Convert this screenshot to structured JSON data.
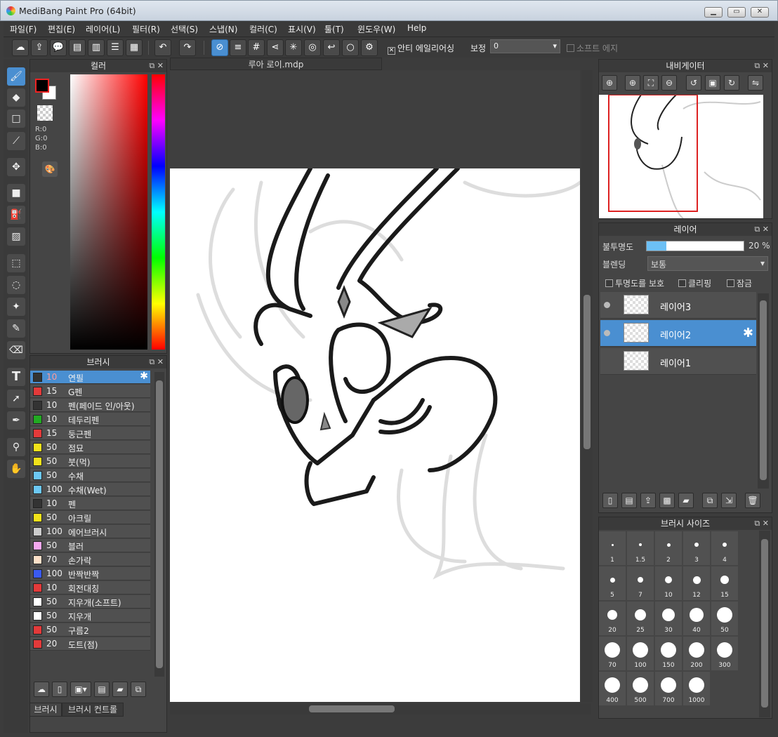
{
  "window": {
    "title": "MediBang Paint Pro (64bit)"
  },
  "menu": [
    "파일(F)",
    "편집(E)",
    "레이어(L)",
    "필터(R)",
    "선택(S)",
    "스냅(N)",
    "컬러(C)",
    "표시(V)",
    "툴(T)",
    "윈도우(W)",
    "Help"
  ],
  "toolbar": {
    "antialias": "안티 에일리어싱",
    "stabilizer_label": "보정",
    "stabilizer_value": "0",
    "soft_edge": "소프트 에지"
  },
  "color_panel": {
    "title": "컬러",
    "r": "R:0",
    "g": "G:0",
    "b": "B:0"
  },
  "brush_panel": {
    "title": "브러시",
    "tab1": "브러시",
    "tab2": "브러시 컨트롤",
    "brushes": [
      {
        "size": "10",
        "name": "연필",
        "color": "#333333"
      },
      {
        "size": "15",
        "name": "G펜",
        "color": "#e33a3a"
      },
      {
        "size": "10",
        "name": "펜(페이드 인/아웃)",
        "color": "#333333"
      },
      {
        "size": "10",
        "name": "테두리펜",
        "color": "#22aa22"
      },
      {
        "size": "15",
        "name": "둥근펜",
        "color": "#e33a3a"
      },
      {
        "size": "50",
        "name": "점묘",
        "color": "#f2e21a"
      },
      {
        "size": "50",
        "name": "붓(먹)",
        "color": "#f2e21a"
      },
      {
        "size": "50",
        "name": "수채",
        "color": "#6cc8f5"
      },
      {
        "size": "100",
        "name": "수채(Wet)",
        "color": "#6cc8f5"
      },
      {
        "size": "10",
        "name": "펜",
        "color": "#333333"
      },
      {
        "size": "50",
        "name": "아크릴",
        "color": "#f2e21a"
      },
      {
        "size": "100",
        "name": "에어브러시",
        "color": "#cccccc"
      },
      {
        "size": "50",
        "name": "블러",
        "color": "#f5a8f0"
      },
      {
        "size": "70",
        "name": "손가락",
        "color": "#fde0c8"
      },
      {
        "size": "100",
        "name": "반짝반짝",
        "color": "#3a5af0"
      },
      {
        "size": "10",
        "name": "회전대칭",
        "color": "#e33a3a"
      },
      {
        "size": "50",
        "name": "지우개(소프트)",
        "color": "#ffffff"
      },
      {
        "size": "50",
        "name": "지우개",
        "color": "#ffffff"
      },
      {
        "size": "50",
        "name": "구름2",
        "color": "#e33a3a"
      },
      {
        "size": "20",
        "name": "도트(점)",
        "color": "#e33a3a"
      }
    ]
  },
  "document": {
    "tab": "루아 로이.mdp"
  },
  "navigator": {
    "title": "내비게이터"
  },
  "layer_panel": {
    "title": "레이어",
    "opacity_label": "불투명도",
    "opacity_value": "20 %",
    "opacity_fraction": 0.2,
    "blend_label": "블렌딩",
    "blend_value": "보통",
    "protect_alpha": "투명도를 보호",
    "clipping": "클리핑",
    "lock": "잠금",
    "layers": [
      {
        "name": "레이어3"
      },
      {
        "name": "레이어2"
      },
      {
        "name": "레이어1"
      }
    ]
  },
  "brush_size_panel": {
    "title": "브러시 사이즈",
    "sizes": [
      "1",
      "1.5",
      "2",
      "3",
      "4",
      "5",
      "7",
      "10",
      "12",
      "15",
      "20",
      "25",
      "30",
      "40",
      "50",
      "70",
      "100",
      "150",
      "200",
      "300",
      "400",
      "500",
      "700",
      "1000"
    ]
  }
}
